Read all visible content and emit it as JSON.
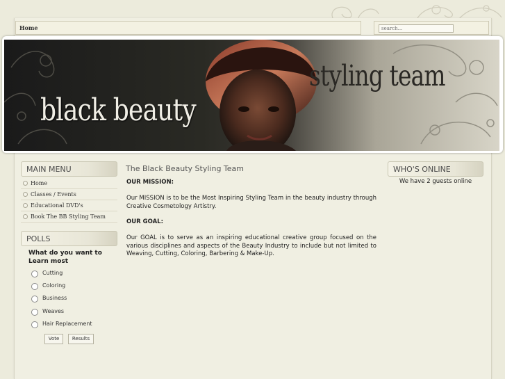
{
  "breadcrumb": {
    "home_label": "Home"
  },
  "search": {
    "placeholder": "search..."
  },
  "banner": {
    "title_left": "black beauty",
    "title_right": "styling team"
  },
  "main_menu": {
    "heading": "MAIN MENU",
    "items": [
      {
        "label": "Home"
      },
      {
        "label": "Classes / Events"
      },
      {
        "label": "Educational DVD's"
      },
      {
        "label": "Book The BB Styling Team"
      }
    ]
  },
  "polls": {
    "heading": "POLLS",
    "question": "What do you want to Learn most",
    "options": [
      {
        "label": "Cutting"
      },
      {
        "label": "Coloring"
      },
      {
        "label": "Business"
      },
      {
        "label": "Weaves"
      },
      {
        "label": "Hair Replacement"
      }
    ],
    "vote_label": "Vote",
    "results_label": "Results"
  },
  "article": {
    "title": "The Black Beauty Styling Team",
    "mission_heading": "OUR MISSION:",
    "mission_text": "Our MISSION is to be the Most Inspiring Styling Team in the beauty industry through Creative Cosmetology Artistry.",
    "goal_heading": "OUR GOAL:",
    "goal_text": "Our GOAL is to serve as an inspiring educational creative group focused on the various disciplines and aspects of the Beauty Industry to include but not limited to Weaving, Cutting, Coloring, Barbering & Make-Up."
  },
  "whos_online": {
    "heading": "WHO'S ONLINE",
    "text": "We have 2 guests online"
  },
  "colors": {
    "background": "#ecebdc",
    "panel": "#f0efe2",
    "banner_dark": "#1a1a1a"
  }
}
